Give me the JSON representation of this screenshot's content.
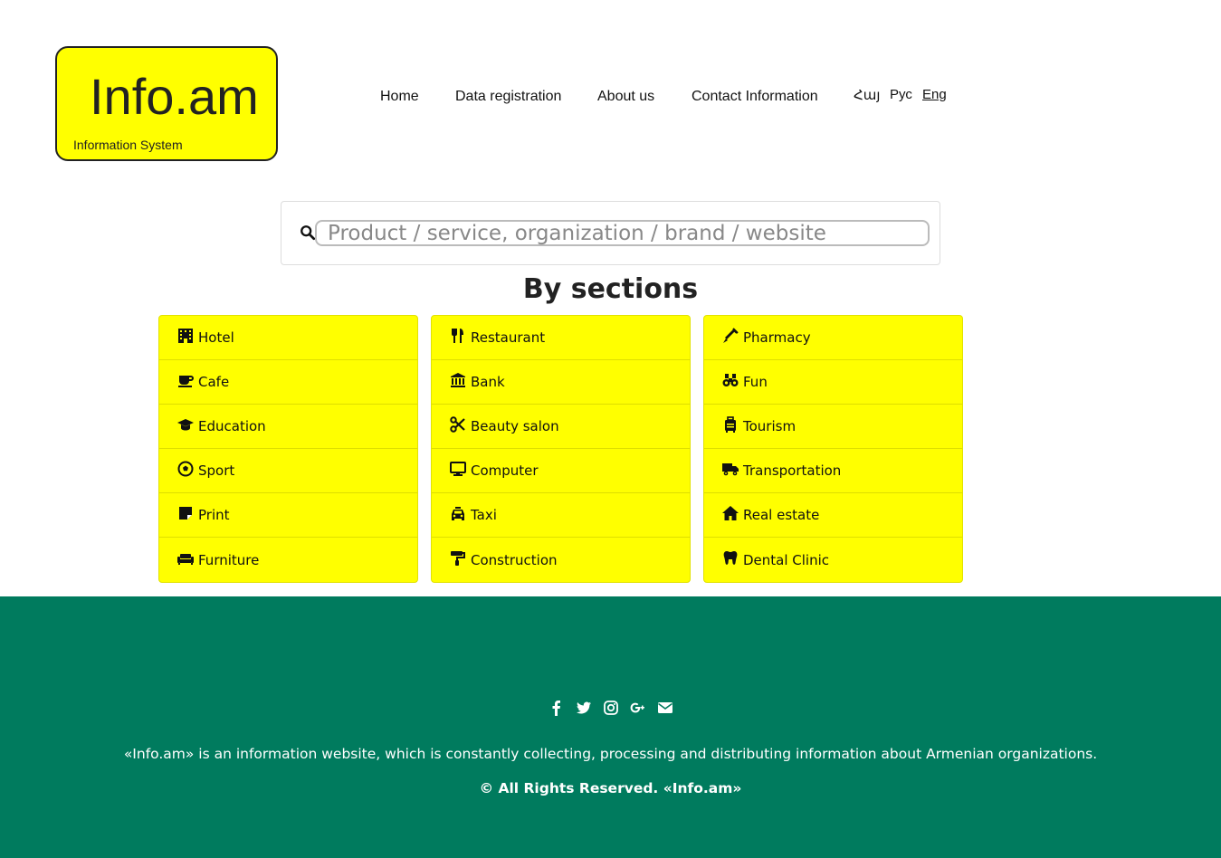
{
  "logo": {
    "title": "Info.am",
    "subtitle": "Information System"
  },
  "nav": {
    "items": [
      "Home",
      "Data registration",
      "About us",
      "Contact Information"
    ],
    "languages": [
      "Հայ",
      "Рус",
      "Eng"
    ],
    "active_language": "Eng"
  },
  "search": {
    "placeholder": "Product / service, organization / brand / website",
    "value": ""
  },
  "sections": {
    "title": "By sections",
    "columns": [
      [
        {
          "label": "Hotel",
          "icon": "hotel-icon"
        },
        {
          "label": "Cafe",
          "icon": "coffee-icon"
        },
        {
          "label": "Education",
          "icon": "graduation-cap-icon"
        },
        {
          "label": "Sport",
          "icon": "soccer-ball-icon"
        },
        {
          "label": "Print",
          "icon": "sticky-note-icon"
        },
        {
          "label": "Furniture",
          "icon": "couch-icon"
        }
      ],
      [
        {
          "label": "Restaurant",
          "icon": "utensils-icon"
        },
        {
          "label": "Bank",
          "icon": "bank-icon"
        },
        {
          "label": "Beauty salon",
          "icon": "scissors-icon"
        },
        {
          "label": "Computer",
          "icon": "desktop-icon"
        },
        {
          "label": "Taxi",
          "icon": "taxi-icon"
        },
        {
          "label": "Construction",
          "icon": "paint-roller-icon"
        }
      ],
      [
        {
          "label": "Pharmacy",
          "icon": "syringe-icon"
        },
        {
          "label": "Fun",
          "icon": "binoculars-icon"
        },
        {
          "label": "Tourism",
          "icon": "suitcase-icon"
        },
        {
          "label": "Transportation",
          "icon": "truck-icon"
        },
        {
          "label": "Real estate",
          "icon": "home-icon"
        },
        {
          "label": "Dental Clinic",
          "icon": "tooth-icon"
        }
      ]
    ]
  },
  "footer": {
    "socials": [
      "facebook-icon",
      "twitter-icon",
      "instagram-icon",
      "google-plus-icon",
      "envelope-icon"
    ],
    "about": "«Info.am» is an information website, which is constantly collecting, processing and distributing information about Armenian organizations.",
    "rights": "© All Rights Reserved.  «Info.am»"
  },
  "colors": {
    "accent": "#ffff00",
    "footer": "#007b5e"
  }
}
